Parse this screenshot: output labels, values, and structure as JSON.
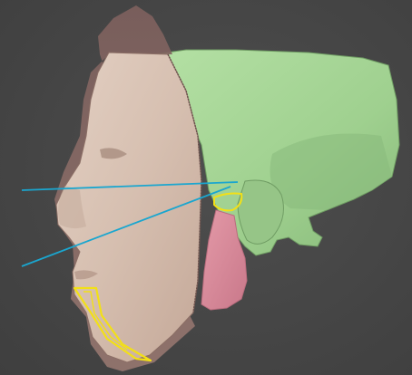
{
  "viewport": {
    "background": "#474747"
  },
  "model": {
    "layers": [
      {
        "name": "skull",
        "color": "#a8d79a"
      },
      {
        "name": "face-skin-translucent",
        "color": "#8f7470"
      },
      {
        "name": "face-skin-cut",
        "color": "#d9c3b4"
      },
      {
        "name": "mandible",
        "color": "#d88a98"
      },
      {
        "name": "chin-marker",
        "color": "#f2e017"
      },
      {
        "name": "ear-marker",
        "color": "#f2e017"
      }
    ],
    "reference_lines": {
      "color": "#1aa6cf",
      "count": 2
    }
  }
}
